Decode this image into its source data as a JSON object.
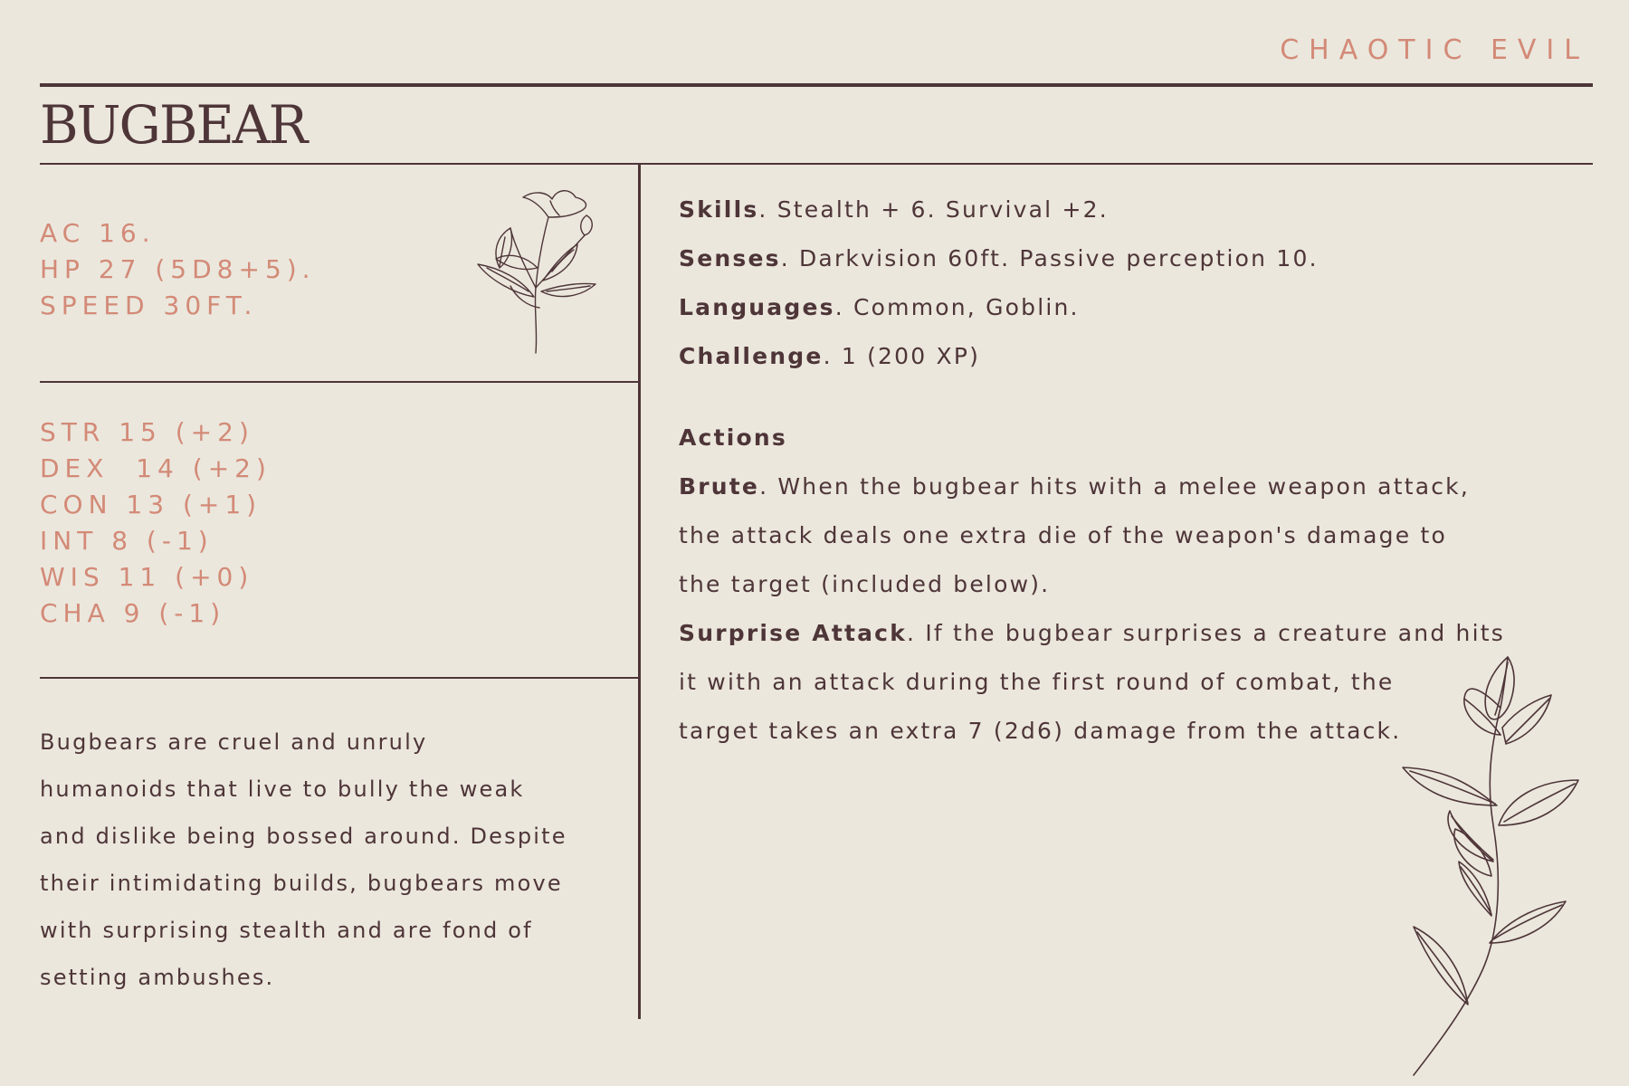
{
  "alignment": "CHAOTIC EVIL",
  "title": "BUGBEAR",
  "basic_stats": [
    "AC 16.",
    "HP 27 (5D8+5).",
    "SPEED 30FT."
  ],
  "abilities": [
    "STR 15 (+2)",
    "DEX  14 (+2)",
    "CON 13 (+1)",
    "INT 8 (-1)",
    "WIS 11 (+0)",
    "CHA 9 (-1)"
  ],
  "description_lines": [
    "Bugbears are cruel and unruly",
    "humanoids that live to bully the weak",
    "and dislike being bossed around. Despite",
    "their intimidating builds, bugbears move",
    "with surprising stealth and are fond of",
    "setting ambushes."
  ],
  "properties": {
    "skills": {
      "label": "Skills",
      "text": ". Stealth + 6. Survival +2."
    },
    "senses": {
      "label": "Senses",
      "text": ".  Darkvision 60ft. Passive perception 10."
    },
    "languages": {
      "label": "Languages",
      "text": ". Common, Goblin."
    },
    "challenge": {
      "label": "Challenge",
      "text": ". 1 (200 XP)"
    }
  },
  "actions": {
    "heading": "Actions",
    "brute": {
      "label": "Brute",
      "first": ". When the bugbear hits with a melee weapon attack,",
      "rest": [
        "the attack deals one extra die of the weapon's damage to",
        "the target (included below)."
      ]
    },
    "surprise": {
      "label": "Surprise Attack",
      "first": ". If the bugbear surprises a creature and hits",
      "rest": [
        "it with an attack during the first round of combat, the",
        "target takes an extra 7 (2d6) damage from the attack."
      ]
    }
  },
  "colors": {
    "background": "#ebe7dd",
    "text": "#4e3538",
    "accent": "#d38a77"
  },
  "icons": [
    "flower-illustration-icon",
    "leaf-branch-illustration-icon"
  ]
}
